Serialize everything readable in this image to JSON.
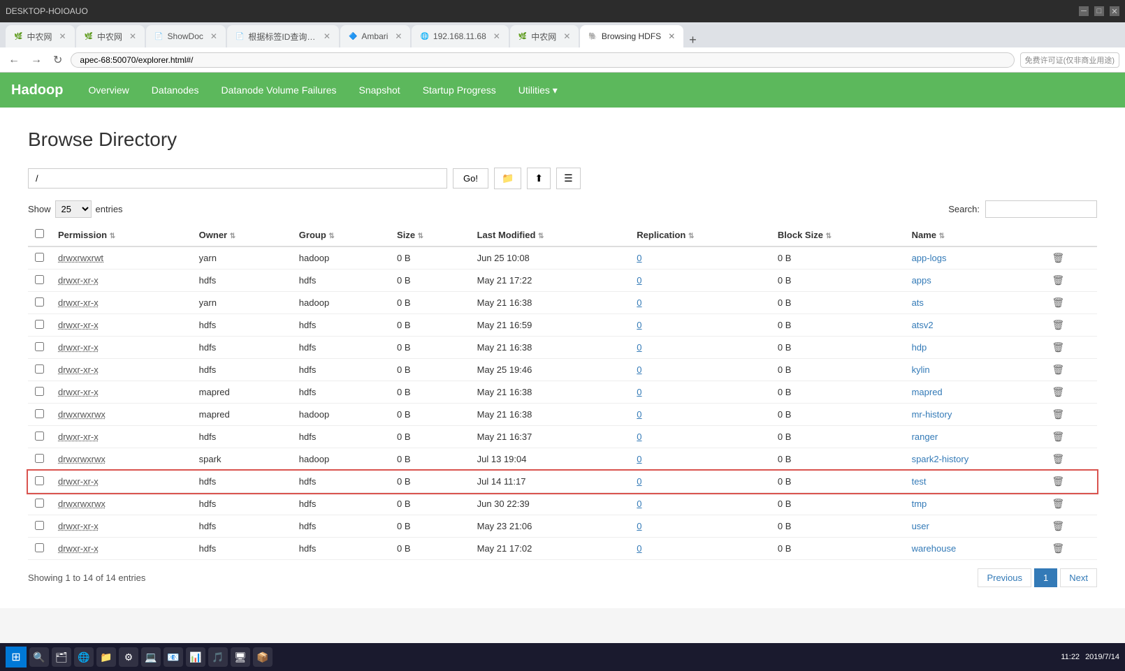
{
  "browser": {
    "title": "DESKTOP-HOIOAUO",
    "tabs": [
      {
        "label": "中农网",
        "active": false,
        "favicon": "🌿"
      },
      {
        "label": "中农网",
        "active": false,
        "favicon": "🌿"
      },
      {
        "label": "ShowDoc",
        "active": false,
        "favicon": "📄"
      },
      {
        "label": "根据标签ID查询表 - Show...",
        "active": false,
        "favicon": "📄"
      },
      {
        "label": "Ambari",
        "active": false,
        "favicon": "🔷"
      },
      {
        "label": "192.168.11.68",
        "active": false,
        "favicon": "🌐"
      },
      {
        "label": "中农网",
        "active": false,
        "favicon": "🌿"
      },
      {
        "label": "Browsing HDFS",
        "active": true,
        "favicon": "🐘"
      }
    ],
    "address": "apec-68:50070/explorer.html#/"
  },
  "nav": {
    "brand": "Hadoop",
    "links": [
      "Overview",
      "Datanodes",
      "Datanode Volume Failures",
      "Snapshot",
      "Startup Progress",
      "Utilities ▾"
    ]
  },
  "page": {
    "title": "Browse Directory"
  },
  "path_input": {
    "value": "/",
    "placeholder": "/",
    "go_label": "Go!",
    "show_label": "Show",
    "entries_label": "entries",
    "search_label": "Search:",
    "entries_value": "25"
  },
  "table": {
    "columns": [
      "Permission",
      "Owner",
      "Group",
      "Size",
      "Last Modified",
      "Replication",
      "Block Size",
      "Name"
    ],
    "rows": [
      {
        "permission": "drwxrwxrwt",
        "owner": "yarn",
        "group": "hadoop",
        "size": "0 B",
        "last_modified": "Jun 25 10:08",
        "replication": "0",
        "block_size": "0 B",
        "name": "app-logs",
        "highlighted": false
      },
      {
        "permission": "drwxr-xr-x",
        "owner": "hdfs",
        "group": "hdfs",
        "size": "0 B",
        "last_modified": "May 21 17:22",
        "replication": "0",
        "block_size": "0 B",
        "name": "apps",
        "highlighted": false
      },
      {
        "permission": "drwxr-xr-x",
        "owner": "yarn",
        "group": "hadoop",
        "size": "0 B",
        "last_modified": "May 21 16:38",
        "replication": "0",
        "block_size": "0 B",
        "name": "ats",
        "highlighted": false
      },
      {
        "permission": "drwxr-xr-x",
        "owner": "hdfs",
        "group": "hdfs",
        "size": "0 B",
        "last_modified": "May 21 16:59",
        "replication": "0",
        "block_size": "0 B",
        "name": "atsv2",
        "highlighted": false
      },
      {
        "permission": "drwxr-xr-x",
        "owner": "hdfs",
        "group": "hdfs",
        "size": "0 B",
        "last_modified": "May 21 16:38",
        "replication": "0",
        "block_size": "0 B",
        "name": "hdp",
        "highlighted": false
      },
      {
        "permission": "drwxr-xr-x",
        "owner": "hdfs",
        "group": "hdfs",
        "size": "0 B",
        "last_modified": "May 25 19:46",
        "replication": "0",
        "block_size": "0 B",
        "name": "kylin",
        "highlighted": false
      },
      {
        "permission": "drwxr-xr-x",
        "owner": "mapred",
        "group": "hdfs",
        "size": "0 B",
        "last_modified": "May 21 16:38",
        "replication": "0",
        "block_size": "0 B",
        "name": "mapred",
        "highlighted": false
      },
      {
        "permission": "drwxrwxrwx",
        "owner": "mapred",
        "group": "hadoop",
        "size": "0 B",
        "last_modified": "May 21 16:38",
        "replication": "0",
        "block_size": "0 B",
        "name": "mr-history",
        "highlighted": false
      },
      {
        "permission": "drwxr-xr-x",
        "owner": "hdfs",
        "group": "hdfs",
        "size": "0 B",
        "last_modified": "May 21 16:37",
        "replication": "0",
        "block_size": "0 B",
        "name": "ranger",
        "highlighted": false
      },
      {
        "permission": "drwxrwxrwx",
        "owner": "spark",
        "group": "hadoop",
        "size": "0 B",
        "last_modified": "Jul 13 19:04",
        "replication": "0",
        "block_size": "0 B",
        "name": "spark2-history",
        "highlighted": false
      },
      {
        "permission": "drwxr-xr-x",
        "owner": "hdfs",
        "group": "hdfs",
        "size": "0 B",
        "last_modified": "Jul 14 11:17",
        "replication": "0",
        "block_size": "0 B",
        "name": "test",
        "highlighted": true
      },
      {
        "permission": "drwxrwxrwx",
        "owner": "hdfs",
        "group": "hdfs",
        "size": "0 B",
        "last_modified": "Jun 30 22:39",
        "replication": "0",
        "block_size": "0 B",
        "name": "tmp",
        "highlighted": false
      },
      {
        "permission": "drwxr-xr-x",
        "owner": "hdfs",
        "group": "hdfs",
        "size": "0 B",
        "last_modified": "May 23 21:06",
        "replication": "0",
        "block_size": "0 B",
        "name": "user",
        "highlighted": false
      },
      {
        "permission": "drwxr-xr-x",
        "owner": "hdfs",
        "group": "hdfs",
        "size": "0 B",
        "last_modified": "May 21 17:02",
        "replication": "0",
        "block_size": "0 B",
        "name": "warehouse",
        "highlighted": false
      }
    ],
    "showing_text": "Showing 1 to 14 of 14 entries"
  },
  "pagination": {
    "previous_label": "Previous",
    "next_label": "Next",
    "current_page": "1"
  },
  "taskbar": {
    "time": "11:22",
    "date": "2019/7/14"
  }
}
